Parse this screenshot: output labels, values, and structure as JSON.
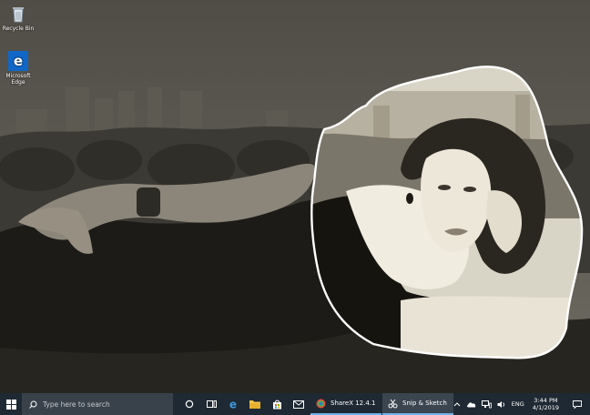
{
  "desktop": {
    "icons": [
      {
        "label": "Recycle Bin",
        "icon": "recycle-bin-icon"
      },
      {
        "label": "Microsoft Edge",
        "icon": "edge-icon"
      }
    ]
  },
  "taskbar": {
    "search_placeholder": "Type here to search",
    "pinned": [
      "cortana-icon",
      "task-view-icon",
      "edge-icon",
      "file-explorer-icon",
      "store-icon",
      "mail-icon"
    ],
    "apps": [
      {
        "label": "ShareX 12.4.1",
        "icon": "sharex-icon",
        "active": false
      },
      {
        "label": "Snip & Sketch",
        "icon": "snip-sketch-icon",
        "active": true
      }
    ],
    "tray": {
      "language": "ENG",
      "time": "3:44 PM",
      "date": "4/1/2019"
    }
  },
  "colors": {
    "taskbar": "#1f2933",
    "search_box": "#39424b",
    "accent": "#6fb3e9",
    "snip_outline": "#ffffff"
  }
}
